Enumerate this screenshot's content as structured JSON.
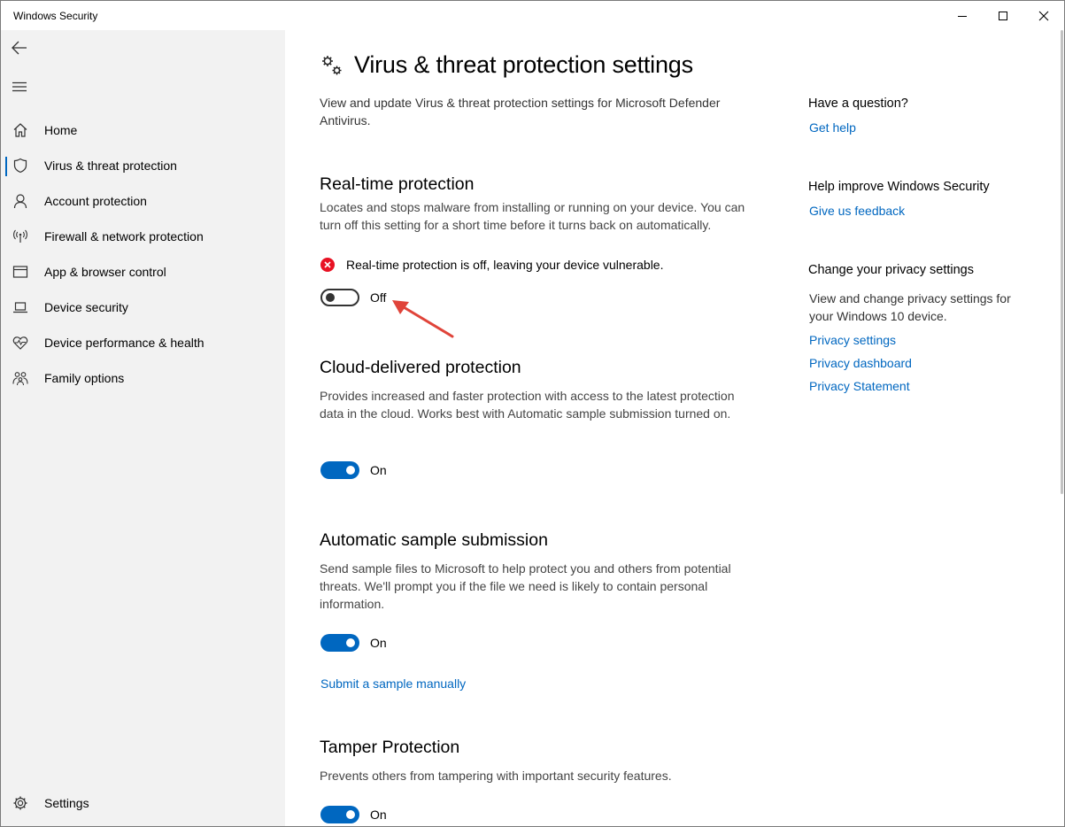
{
  "window": {
    "title": "Windows Security"
  },
  "sidebar": {
    "items": [
      {
        "label": "Home",
        "icon": "home-icon"
      },
      {
        "label": "Virus & threat protection",
        "icon": "shield-icon",
        "active": true
      },
      {
        "label": "Account protection",
        "icon": "person-icon"
      },
      {
        "label": "Firewall & network protection",
        "icon": "antenna-icon"
      },
      {
        "label": "App & browser control",
        "icon": "browser-window-icon"
      },
      {
        "label": "Device security",
        "icon": "laptop-icon"
      },
      {
        "label": "Device performance & health",
        "icon": "heart-pulse-icon"
      },
      {
        "label": "Family options",
        "icon": "family-icon"
      }
    ],
    "settings_label": "Settings"
  },
  "main": {
    "title": "Virus & threat protection settings",
    "description": "View and update Virus & threat protection settings for Microsoft Defender Antivirus.",
    "realtime": {
      "title": "Real-time protection",
      "description": "Locates and stops malware from installing or running on your device. You can turn off this setting for a short time before it turns back on automatically.",
      "warning": "Real-time protection is off, leaving your device vulnerable.",
      "toggle_label": "Off",
      "enabled": false
    },
    "cloud": {
      "title": "Cloud-delivered protection",
      "description": "Provides increased and faster protection with access to the latest protection data in the cloud. Works best with Automatic sample submission turned on.",
      "toggle_label": "On",
      "enabled": true
    },
    "sample": {
      "title": "Automatic sample submission",
      "description": "Send sample files to Microsoft to help protect you and others from potential threats. We'll prompt you if the file we need is likely to contain personal information.",
      "toggle_label": "On",
      "enabled": true,
      "submit_link": "Submit a sample manually"
    },
    "tamper": {
      "title": "Tamper Protection",
      "description": "Prevents others from tampering with important security features.",
      "toggle_label": "On",
      "enabled": true
    }
  },
  "aside": {
    "question_heading": "Have a question?",
    "get_help": "Get help",
    "improve_heading": "Help improve Windows Security",
    "feedback": "Give us feedback",
    "privacy_heading": "Change your privacy settings",
    "privacy_desc": "View and change privacy settings for your Windows 10 device.",
    "privacy_settings": "Privacy settings",
    "privacy_dashboard": "Privacy dashboard",
    "privacy_statement": "Privacy Statement"
  },
  "colors": {
    "accent": "#0067c0",
    "error": "#e81123",
    "sidebar_bg": "#f2f2f2",
    "arrow": "#e0443a"
  }
}
